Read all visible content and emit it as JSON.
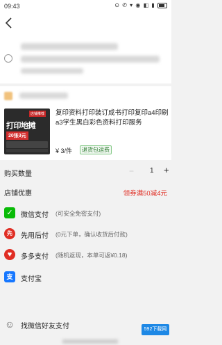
{
  "status": {
    "time": "09:43",
    "icons": "⊙ ✆ ▾ ◉ ◧ ▮",
    "battery": ""
  },
  "product": {
    "title": "复印资料打印装订成书打印复印a4印刷a3学生黑白彩色资料打印服务",
    "price": "¥ 3/件",
    "return_badge": "退货包运费",
    "thumb": {
      "tag": "店铺推荐",
      "title": "打印地摊",
      "price_tag": "20张3元"
    }
  },
  "order": {
    "qty_label": "购买数量",
    "qty_minus": "−",
    "qty_value": "1",
    "qty_plus": "+",
    "coupon_label": "店铺优惠",
    "coupon_value": "领券满50减4元"
  },
  "payments": [
    {
      "name": "微信支付",
      "desc": "(可安全免密支付)",
      "icon": "wechat-pay-icon",
      "color": "#09bb07",
      "glyph": "✓"
    },
    {
      "name": "先用后付",
      "desc": "(0元下单，确认收货后付款)",
      "icon": "pay-later-icon",
      "color": "#e02e24",
      "glyph": "先"
    },
    {
      "name": "多多支付",
      "desc": "(随机返现，本单可返¥0.18)",
      "icon": "duoduo-pay-icon",
      "color": "#e02e24",
      "glyph": "♥"
    },
    {
      "name": "支付宝",
      "desc": "",
      "icon": "alipay-icon",
      "color": "#1677ff",
      "glyph": "支"
    },
    {
      "name": "找微信好友支付",
      "desc": "",
      "icon": "friend-pay-icon",
      "color": "#666666",
      "glyph": "☺"
    }
  ],
  "watermark": "592下载网"
}
